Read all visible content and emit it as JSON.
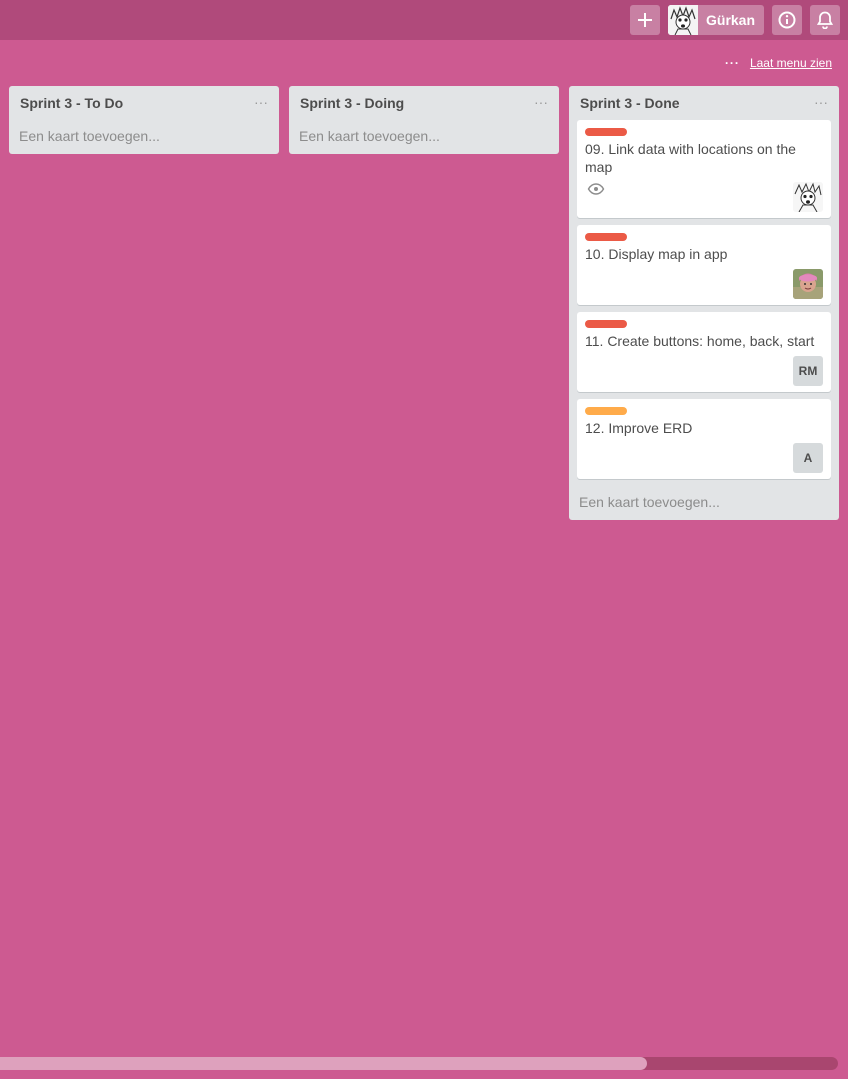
{
  "header": {
    "member_name": "Gürkan"
  },
  "board": {
    "show_menu_label": "Laat menu zien",
    "show_menu_dots": "···"
  },
  "lists": [
    {
      "title": "Sprint 3 - To Do",
      "menu": "···",
      "add_card": "Een kaart toevoegen..."
    },
    {
      "title": "Sprint 3 - Doing",
      "menu": "···",
      "add_card": "Een kaart toevoegen..."
    },
    {
      "title": "Sprint 3 - Done",
      "menu": "···",
      "add_card": "Een kaart toevoegen...",
      "cards": [
        {
          "title": "09. Link data with locations on the map",
          "label_color": "#eb5a46",
          "watching": true,
          "member": "avatar-cartoon"
        },
        {
          "title": "10. Display map in app",
          "label_color": "#eb5a46",
          "watching": false,
          "member": "avatar-photo"
        },
        {
          "title": "11. Create buttons: home, back, start",
          "label_color": "#eb5a46",
          "watching": false,
          "member_initials": "RM"
        },
        {
          "title": "12. Improve ERD",
          "label_color": "#ffab4a",
          "watching": false,
          "member_initials": "A"
        }
      ]
    }
  ],
  "colors": {
    "board_bg": "#cd5a91",
    "header_bg": "#b04a7b",
    "list_bg": "#e2e4e6",
    "label_red": "#eb5a46",
    "label_orange": "#ffab4a"
  }
}
